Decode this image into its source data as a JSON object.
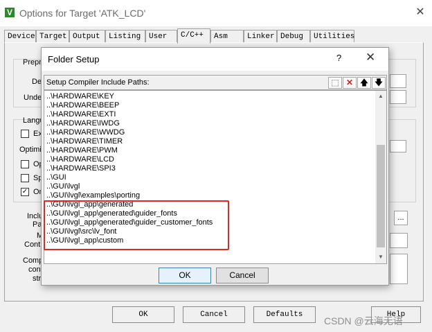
{
  "window": {
    "title": "Options for Target 'ATK_LCD'",
    "icon": "keil-uvision-icon",
    "close_glyph": "✕"
  },
  "tabs": [
    "Device",
    "Target",
    "Output",
    "Listing",
    "User",
    "C/C++",
    "Asm",
    "Linker",
    "Debug",
    "Utilities"
  ],
  "active_tab": "C/C++",
  "background_labels": {
    "preprocessor": "Prepro",
    "define": "De",
    "undefine": "Unde",
    "language": "Langu",
    "execute_only": "Ex",
    "optimization": "Optimiz",
    "opt": "Op",
    "split": "Sp",
    "one_elf": "On",
    "include_paths": "Inclu",
    "paths": "Pa",
    "misc": "M",
    "controls": "Contr",
    "compiler": "Comp",
    "control": "con",
    "string": "str",
    "browse_button": "..."
  },
  "background_checks": [
    false,
    false,
    false,
    true
  ],
  "bottom_buttons": {
    "ok": "OK",
    "cancel": "Cancel",
    "defaults": "Defaults",
    "help": "Help"
  },
  "watermark": "CSDN @云海无语",
  "dialog": {
    "title": "Folder Setup",
    "help_glyph": "?",
    "close_glyph": "✕",
    "paths_label": "Setup Compiler Include Paths:",
    "toolbar": {
      "new_glyph": "⬚",
      "delete_glyph": "✕",
      "up_glyph": "🡅",
      "down_glyph": "🡇"
    },
    "paths": [
      "..\\HARDWARE\\KEY",
      "..\\HARDWARE\\BEEP",
      "..\\HARDWARE\\EXTI",
      "..\\HARDWARE\\IWDG",
      "..\\HARDWARE\\WWDG",
      "..\\HARDWARE\\TIMER",
      "..\\HARDWARE\\PWM",
      "..\\HARDWARE\\LCD",
      "..\\HARDWARE\\SPI3",
      "..\\GUI",
      "..\\GUI\\lvgl",
      "..\\GUI\\lvgl\\examples\\porting",
      "..\\GUI\\lvgl_app\\generated",
      "..\\GUI\\lvgl_app\\generated\\guider_fonts",
      "..\\GUI\\lvgl_app\\generated\\guider_customer_fonts",
      "..\\GUI\\lvgl\\src\\lv_font",
      "..\\GUI\\lvgl_app\\custom"
    ],
    "highlight_color": "#e0281e",
    "ok_label": "OK",
    "cancel_label": "Cancel"
  }
}
